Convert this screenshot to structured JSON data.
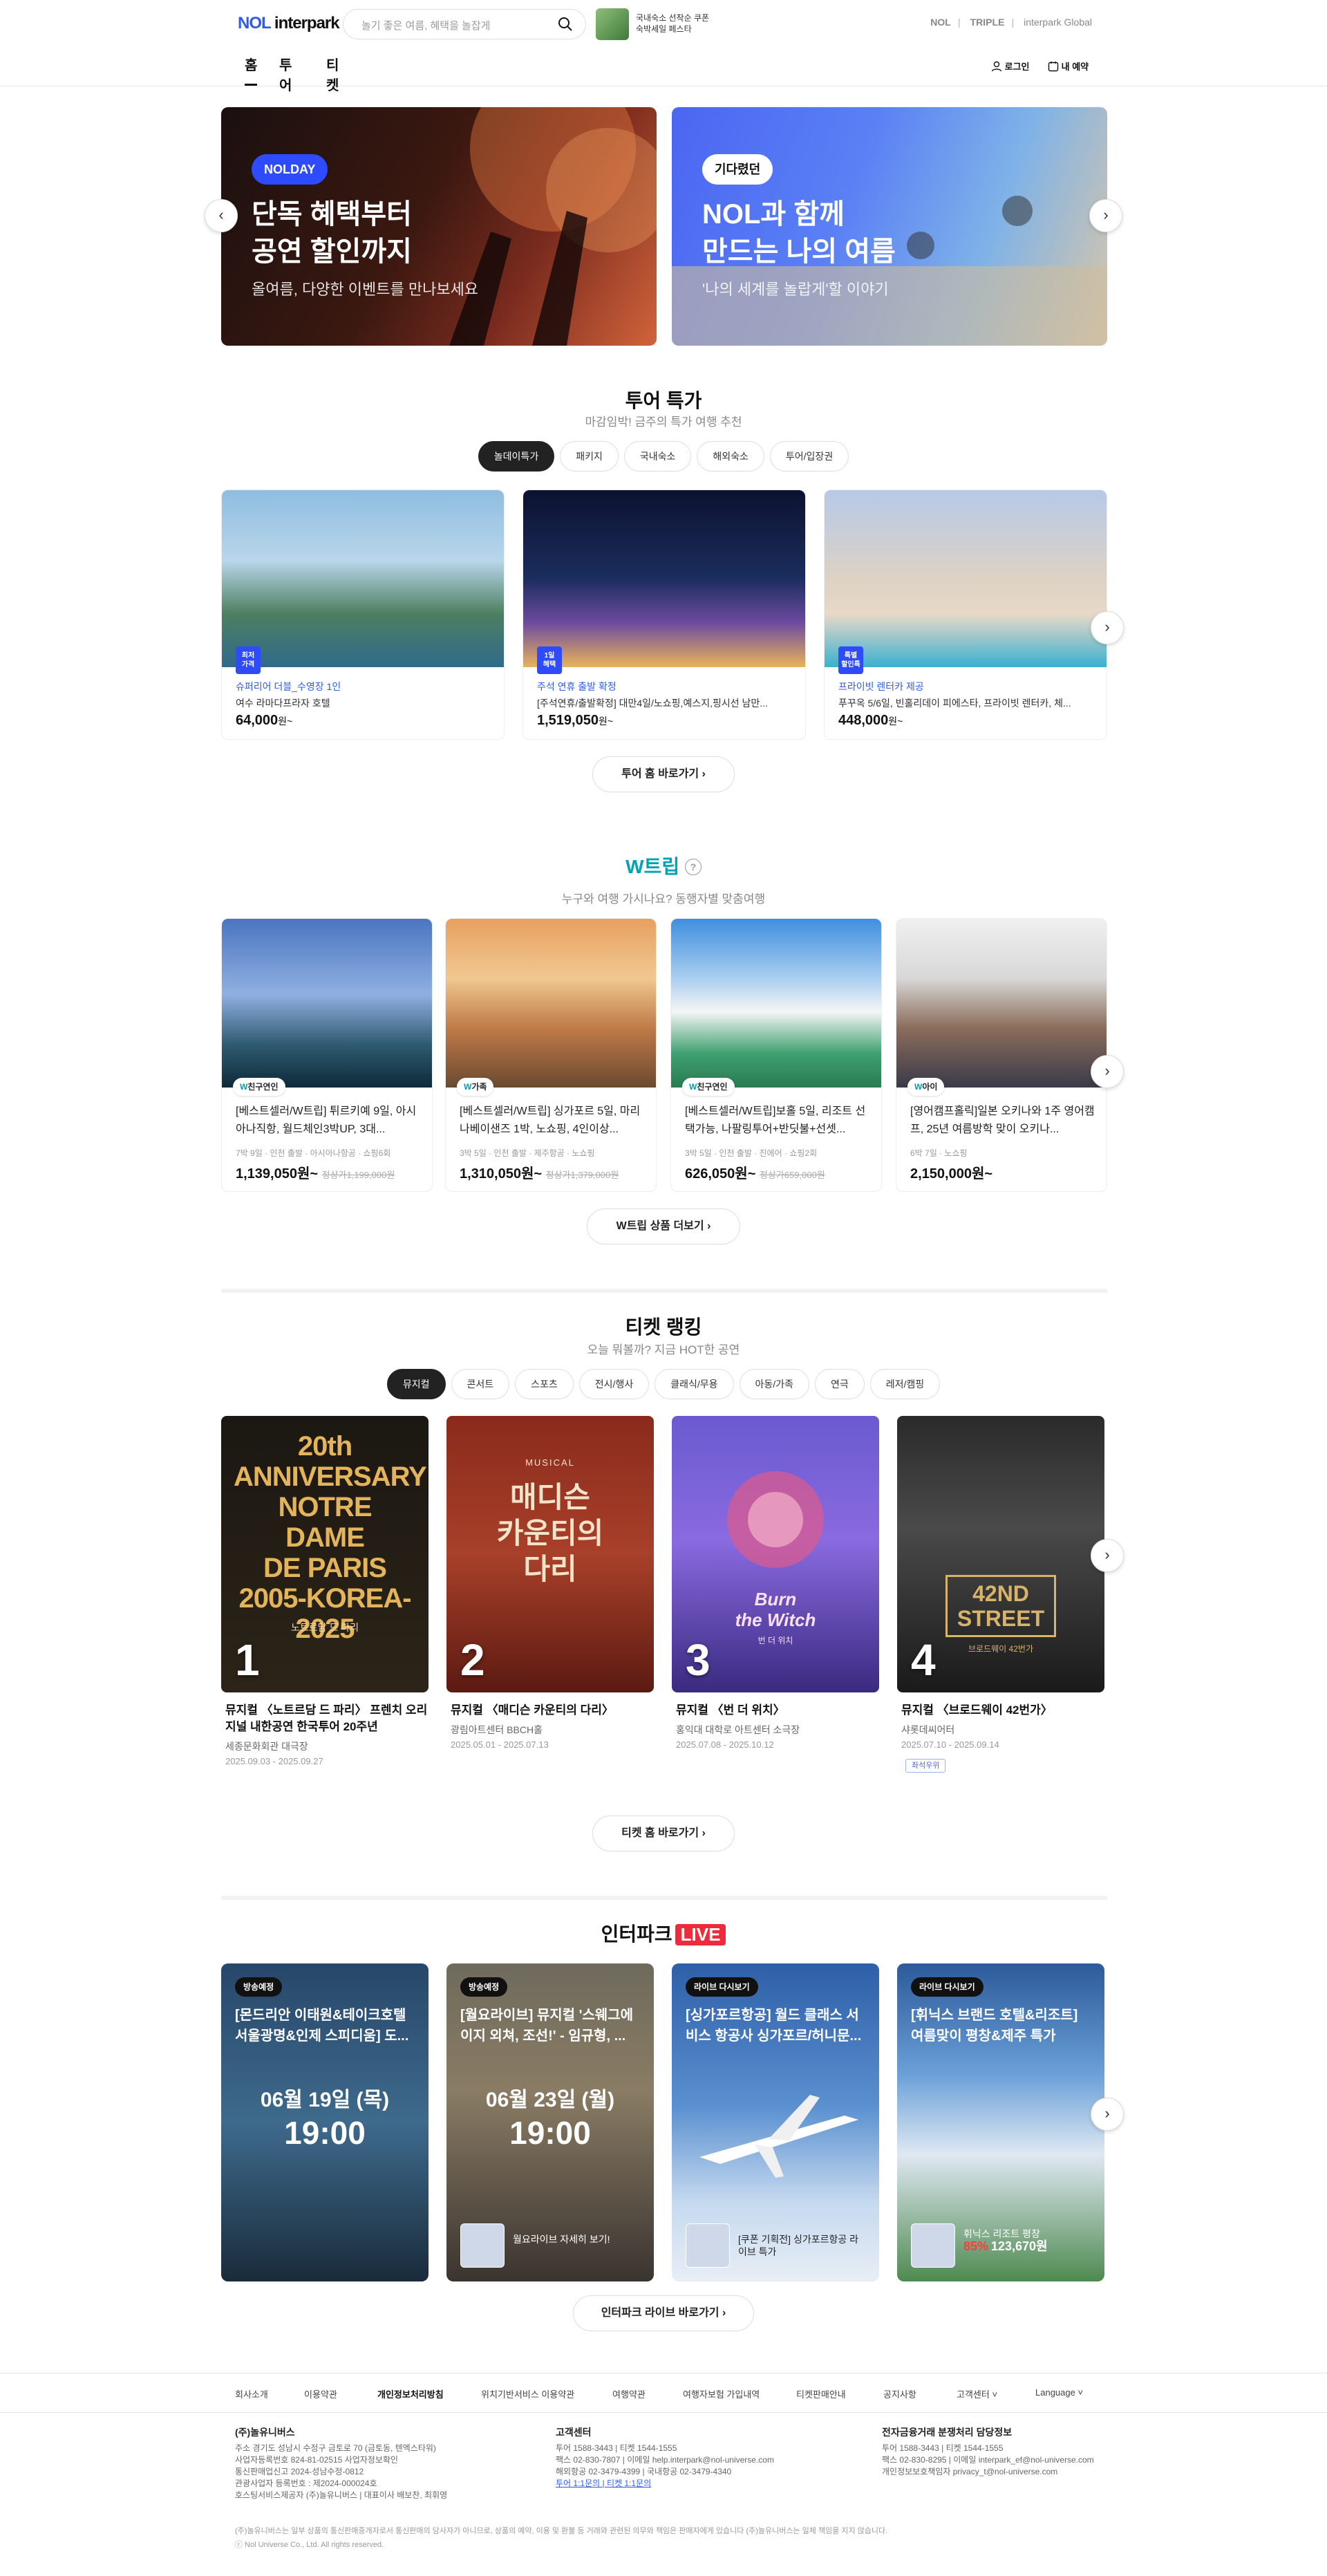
{
  "header": {
    "logo_nol": "NOL",
    "logo_rest": " interpark",
    "search_placeholder": "놀기 좋은 여름, 혜택을 놀잡게",
    "promo_text": "국내숙소 선착순 쿠폰\n숙박세일 페스타",
    "links": [
      "NOL",
      "TRIPLE",
      "interpark Global"
    ],
    "tabs": [
      "홈",
      "투어",
      "티켓"
    ],
    "login": "로그인",
    "my_reservation": "내 예약"
  },
  "banners": [
    {
      "pill": "NOLDAY",
      "title": "단독 혜택부터\n공연 할인까지",
      "sub": "올여름, 다양한 이벤트를 만나보세요"
    },
    {
      "pill": "기다렸던",
      "title": "NOL과 함께\n만드는 나의 여름",
      "sub": "'나의 세계를 놀랍게'할 이야기"
    }
  ],
  "tour": {
    "title": "투어 특가",
    "sub": "마감임박! 금주의 특가 여행 추천",
    "chips": [
      "놀데이특가",
      "패키지",
      "국내숙소",
      "해외숙소",
      "투어/입장권"
    ],
    "cards": [
      {
        "badge": "최저\n가격",
        "tag": "슈퍼리어 더블_수영장 1인",
        "name": "여수 라마다프라자 호텔",
        "price": "64,000",
        "unit": "원~"
      },
      {
        "badge": "1일\n혜택",
        "tag": "주석 연휴 출발 확정",
        "name": "[주석연휴/출발확정] 대만4일/노쇼핑,예스지,핑시선 남만...",
        "price": "1,519,050",
        "unit": "원~"
      },
      {
        "badge": "특별\n할인특",
        "tag": "프라이빗 렌터카 제공",
        "name": "푸꾸옥 5/6일, 빈홀리데이 피에스타, 프라이빗 렌터카, 체...",
        "price": "448,000",
        "unit": "원~"
      }
    ],
    "more": "투어 홈 바로가기 ›"
  },
  "wtrip": {
    "logo": "W트립",
    "help": "?",
    "sub": "누구와 여행 가시나요? 동행자별 맞춤여행",
    "cards": [
      {
        "badge_w": "W",
        "badge": "친구연인",
        "name": "[베스트셀러/W트립] 튀르키예 9일, 아시아나직항, 월드체인3박UP, 3대...",
        "meta": "7박 9일 · 인천 출발 · 아시아나항공 · 쇼핑6회",
        "price": "1,139,050원~",
        "old": "정상가1,199,000원"
      },
      {
        "badge_w": "W",
        "badge": "가족",
        "name": "[베스트셀러/W트립] 싱가포르 5일, 마리나베이샌즈 1박, 노쇼핑, 4인이상...",
        "meta": "3박 5일 · 인천 출발 · 제주항공 · 노쇼핑",
        "price": "1,310,050원~",
        "old": "정상가1,379,000원"
      },
      {
        "badge_w": "W",
        "badge": "친구연인",
        "name": "[베스트셀러/W트립]보홀 5일, 리조트 선택가능, 나팔링투어+반딧불+선셋...",
        "meta": "3박 5일 · 인천 출발 · 진에어 · 쇼핑2회",
        "price": "626,050원~",
        "old": "정상가659,000원"
      },
      {
        "badge_w": "W",
        "badge": "아이",
        "name": "[영어캠프홀릭]일본 오키나와 1주 영어캠프, 25년 여름방학 맞이 오키나...",
        "meta": "6박 7일 · 노쇼핑",
        "price": "2,150,000원~",
        "old": ""
      }
    ],
    "more": "W트립 상품 더보기 ›"
  },
  "ticket": {
    "title": "티켓 랭킹",
    "sub": "오늘 뭐볼까? 지금 HOT한 공연",
    "chips": [
      "뮤지컬",
      "콘서트",
      "스포츠",
      "전시/행사",
      "클래식/무용",
      "아동/가족",
      "연극",
      "레저/캠핑"
    ],
    "items": [
      {
        "rank": "1",
        "poster_title": "20th ANNIVERSARY\nNOTRE\nDAME\nDE PARIS\n2005-KOREA-2025",
        "poster_sub": "노트르담 드 파리",
        "name": "뮤지컬 〈노트르담 드 파리〉 프렌치 오리지널 내한공연 한국투어 20주년",
        "venue": "세종문화회관 대극장",
        "date": "2025.09.03 - 2025.09.27",
        "flag": ""
      },
      {
        "rank": "2",
        "poster_title": "매디슨\n카운티의\n다리",
        "poster_sub": "MUSICAL",
        "name": "뮤지컬 〈매디슨 카운티의 다리〉",
        "venue": "광림아트센터 BBCH홀",
        "date": "2025.05.01 - 2025.07.13",
        "flag": ""
      },
      {
        "rank": "3",
        "poster_title": "Burn\nthe Witch",
        "poster_sub": "번 더 위치",
        "name": "뮤지컬 〈번 더 위치〉",
        "venue": "홍익대 대학로 아트센터 소극장",
        "date": "2025.07.08 - 2025.10.12",
        "flag": ""
      },
      {
        "rank": "4",
        "poster_title": "42ND\nSTREET",
        "poster_sub": "브로드웨이 42번가",
        "name": "뮤지컬 〈브로드웨이 42번가〉",
        "venue": "샤롯데씨어터",
        "date": "2025.07.10 - 2025.09.14",
        "flag": "좌석우위"
      }
    ],
    "more": "티켓 홈 바로가기 ›"
  },
  "live": {
    "title_1": "인터파크",
    "title_2": "LIVE",
    "cards": [
      {
        "tag": "방송예정",
        "title": "[몬드리안 이태원&테이크호텔 서울광명&인제 스피디움] 도...",
        "date": "06월 19일 (목)",
        "time": "19:00",
        "foot": ""
      },
      {
        "tag": "방송예정",
        "title": "[월요라이브] 뮤지컬 '스웨그에이지 외쳐, 조선!' - 임규형, ...",
        "date": "06월 23일 (월)",
        "time": "19:00",
        "foot": "월요라이브 자세히 보기!"
      },
      {
        "tag": "라이브 다시보기",
        "title": "[싱가포르항공] 월드 클래스 서비스 항공사 싱가포르/허니문...",
        "date": "",
        "time": "",
        "foot": "[쿠폰 기획전] 싱가포르항공 라이브 특가"
      },
      {
        "tag": "라이브 다시보기",
        "title": "[휘닉스 브랜드 호텔&리조트] 여름맞이 평창&제주 특가",
        "date": "",
        "time": "",
        "foot": "휘닉스 리조트 평창",
        "pct": "85%",
        "fprice": "123,670원"
      }
    ],
    "more": "인터파크 라이브 바로가기 ›"
  },
  "footer": {
    "nav": [
      "회사소개",
      "이용약관",
      "개인정보처리방침",
      "위치기반서비스 이용약관",
      "여행약관",
      "여행자보험 가입내역",
      "티켓판매안내",
      "공지사항",
      "고객센터 ˅",
      "Language ˅"
    ],
    "company": {
      "h": "(주)놀유니버스",
      "lines": [
        "주소 경기도 성남시 수정구 금토로 70 (금토동, 텐엑스타워)",
        "사업자등록번호 824-81-02515 사업자정보확인",
        "통신판매업신고 2024-성남수정-0812",
        "관광사업자 등록번호 : 제2024-000024호",
        "호스팅서비스제공자 (주)놀유니버스 | 대표이사 배보찬, 최휘영"
      ]
    },
    "center": {
      "h": "고객센터",
      "lines": [
        "투어 1588-3443 | 티켓 1544-1555",
        "팩스 02-830-7807 | 이메일 help.interpark@nol-universe.com",
        "해외항공 02-3479-4399 | 국내항공 02-3479-4340",
        "투어 1:1문의 | 티켓 1:1문의"
      ]
    },
    "dispute": {
      "h": "전자금융거래 분쟁처리 담당정보",
      "lines": [
        "투어 1588-3443 | 티켓 1544-1555",
        "팩스 02-830-8295 | 이메일 interpark_ef@nol-universe.com",
        "개인정보보호책임자 privacy_t@nol-universe.com"
      ]
    },
    "note": "(주)놀유니버스는 일부 상품의 통신판매중개자로서 통신판매의 당사자가 아니므로, 상품의 예약, 이용 및 환불 등 거래와 관련된 의무와 책임은 판매자에게 있습니다 (주)놀유니버스는 일체 책임을 지지 않습니다.",
    "copyright": "ⓒ Nol Universe Co., Ltd. All rights reserved."
  }
}
